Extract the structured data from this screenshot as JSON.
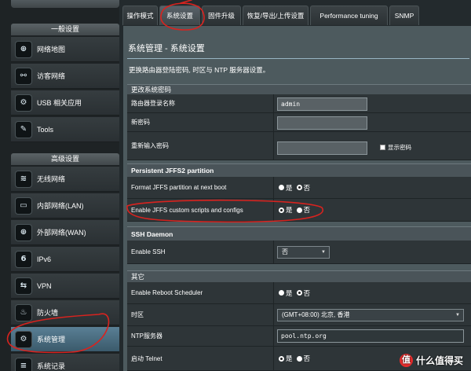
{
  "sidebar": {
    "general_header": "一般设置",
    "general_items": [
      {
        "label": "网络地图",
        "icon": "network-map-icon",
        "glyph": "⊕"
      },
      {
        "label": "访客网络",
        "icon": "guest-network-icon",
        "glyph": "⚯"
      },
      {
        "label": "USB 相关应用",
        "icon": "usb-apps-icon",
        "glyph": "⚙"
      },
      {
        "label": "Tools",
        "icon": "wrench-icon",
        "glyph": "✎"
      }
    ],
    "advanced_header": "高级设置",
    "advanced_items": [
      {
        "label": "无线网络",
        "icon": "wireless-icon",
        "glyph": "≋"
      },
      {
        "label": "内部网络(LAN)",
        "icon": "lan-icon",
        "glyph": "▭"
      },
      {
        "label": "外部网络(WAN)",
        "icon": "wan-globe-icon",
        "glyph": "⊕"
      },
      {
        "label": "IPv6",
        "icon": "ipv6-icon",
        "glyph": "6"
      },
      {
        "label": "VPN",
        "icon": "vpn-icon",
        "glyph": "⇆"
      },
      {
        "label": "防火墙",
        "icon": "firewall-icon",
        "glyph": "♨"
      },
      {
        "label": "系统管理",
        "icon": "administration-icon",
        "glyph": "⚙",
        "active": true
      },
      {
        "label": "系统记录",
        "icon": "system-log-icon",
        "glyph": "≡"
      }
    ]
  },
  "tabs": [
    {
      "label": "操作模式"
    },
    {
      "label": "系统设置",
      "active": true
    },
    {
      "label": "固件升级"
    },
    {
      "label": "恢复/导出/上传设置"
    },
    {
      "label": "Performance tuning"
    },
    {
      "label": "SNMP"
    }
  ],
  "page": {
    "title": "系统管理 - 系统设置",
    "description": "更换路由器登陆密码, 时区与 NTP 服务器设置。"
  },
  "password_section": {
    "header": "更改系统密码",
    "login_name_label": "路由器登录名称",
    "login_name_value": "admin",
    "new_password_label": "新密码",
    "confirm_password_label": "重新输入密码",
    "show_password_label": "显示密码"
  },
  "jffs_section": {
    "header": "Persistent JFFS2 partition",
    "format_label": "Format JFFS partition at next boot",
    "custom_scripts_label": "Enable JFFS custom scripts and configs",
    "yes": "是",
    "no": "否"
  },
  "ssh_section": {
    "header": "SSH Daemon",
    "enable_ssh_label": "Enable SSH",
    "enable_ssh_value": "否"
  },
  "misc_section": {
    "header": "其它",
    "reboot_scheduler_label": "Enable Reboot Scheduler",
    "timezone_label": "时区",
    "timezone_value": "(GMT+08:00) 北京, 香港",
    "ntp_label": "NTP服务器",
    "ntp_value": "pool.ntp.org",
    "telnet_label": "启动 Telnet",
    "yes": "是",
    "no": "否"
  },
  "watermark": {
    "logo_text": "值",
    "text": "什么值得买"
  },
  "colors": {
    "annotation": "#d8231f",
    "panel": "#4d5a5e",
    "row": "#2e3538"
  }
}
